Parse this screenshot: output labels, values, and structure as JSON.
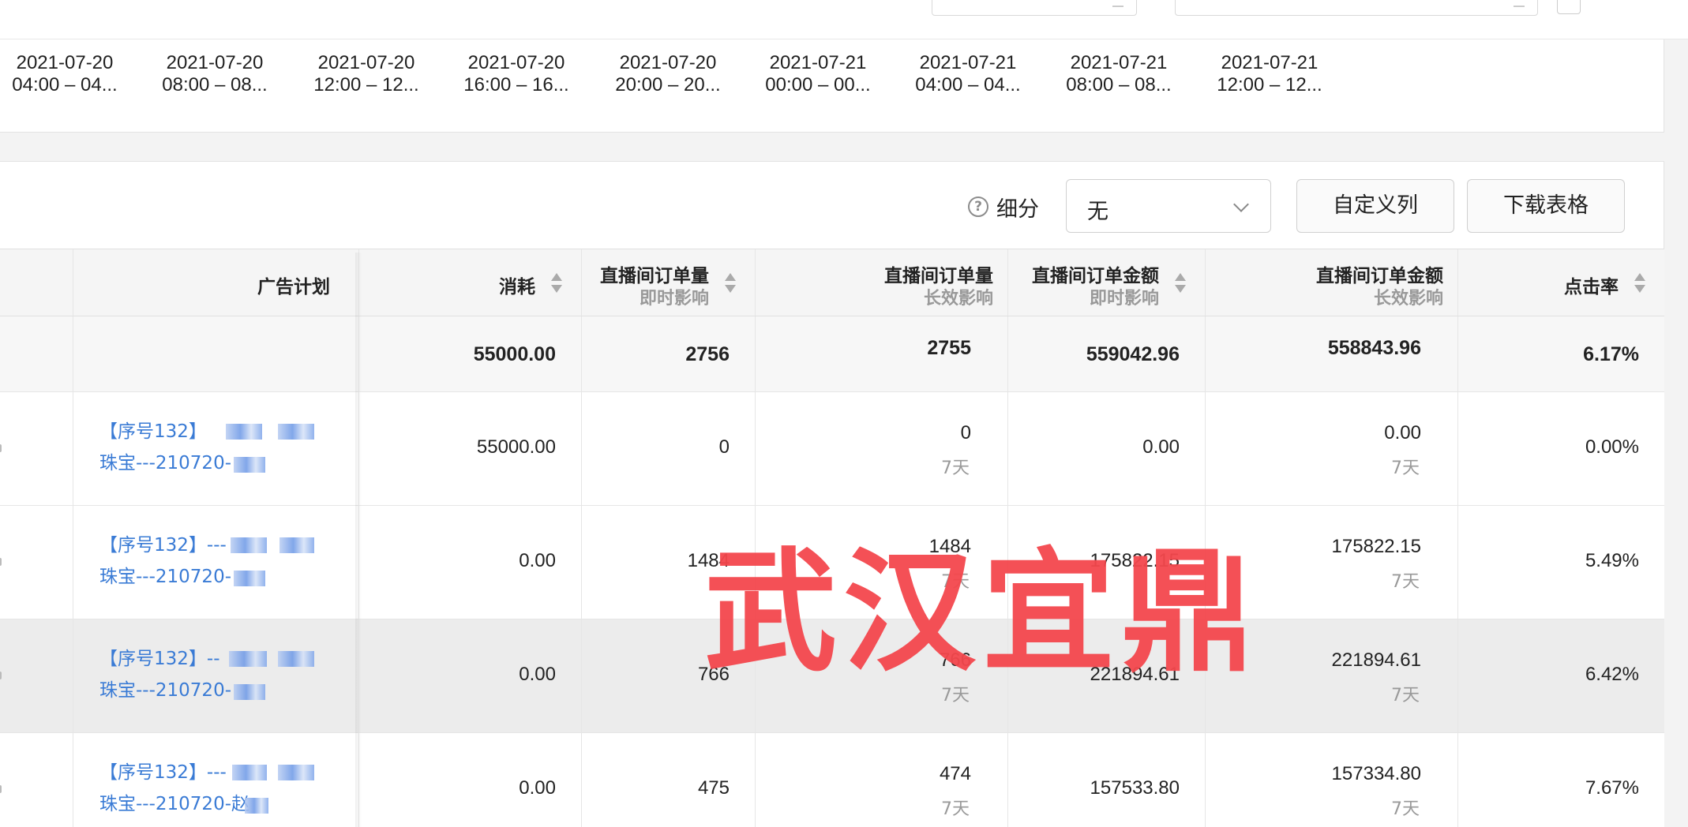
{
  "timeline": [
    {
      "date": "2021-07-20",
      "range": "04:00 – 04..."
    },
    {
      "date": "2021-07-20",
      "range": "08:00 – 08..."
    },
    {
      "date": "2021-07-20",
      "range": "12:00 – 12..."
    },
    {
      "date": "2021-07-20",
      "range": "16:00 – 16..."
    },
    {
      "date": "2021-07-20",
      "range": "20:00 – 20..."
    },
    {
      "date": "2021-07-21",
      "range": "00:00 – 00..."
    },
    {
      "date": "2021-07-21",
      "range": "04:00 – 04..."
    },
    {
      "date": "2021-07-21",
      "range": "08:00 – 08..."
    },
    {
      "date": "2021-07-21",
      "range": "12:00 – 12..."
    }
  ],
  "toolbar": {
    "segment_label": "细分",
    "segment_value": "无",
    "custom_columns": "自定义列",
    "download_table": "下载表格"
  },
  "columns": {
    "plan": "广告计划",
    "cost": "消耗",
    "orders_instant": {
      "title": "直播间订单量",
      "sub": "即时影响"
    },
    "orders_long": {
      "title": "直播间订单量",
      "sub": "长效影响"
    },
    "amount_instant": {
      "title": "直播间订单金额",
      "sub": "即时影响"
    },
    "amount_long": {
      "title": "直播间订单金额",
      "sub": "长效影响"
    },
    "ctr": "点击率"
  },
  "total": {
    "cost": "55000.00",
    "orders_instant": "2756",
    "orders_long": "2755",
    "amount_instant": "559042.96",
    "amount_long": "558843.96",
    "ctr": "6.17%"
  },
  "rows": [
    {
      "plan_l1": "【序号132】",
      "plan_l2": "珠宝---210720-",
      "cost": "55000.00",
      "orders_instant": "0",
      "orders_long": "0",
      "orders_long_sub": "7天",
      "amount_instant": "0.00",
      "amount_long": "0.00",
      "amount_long_sub": "7天",
      "ctr": "0.00%"
    },
    {
      "plan_l1": "【序号132】---",
      "plan_l2": "珠宝---210720-",
      "cost": "0.00",
      "orders_instant": "1484",
      "orders_long": "1484",
      "orders_long_sub": "7天",
      "amount_instant": "175822.15",
      "amount_long": "175822.15",
      "amount_long_sub": "7天",
      "ctr": "5.49%"
    },
    {
      "plan_l1": "【序号132】--",
      "plan_l2": "珠宝---210720-",
      "cost": "0.00",
      "orders_instant": "766",
      "orders_long": "766",
      "orders_long_sub": "7天",
      "amount_instant": "221894.61",
      "amount_long": "221894.61",
      "amount_long_sub": "7天",
      "ctr": "6.42%"
    },
    {
      "plan_l1": "【序号132】---",
      "plan_l2": "珠宝---210720-赵",
      "cost": "0.00",
      "orders_instant": "475",
      "orders_long": "474",
      "orders_long_sub": "7天",
      "amount_instant": "157533.80",
      "amount_long": "157334.80",
      "amount_long_sub": "7天",
      "ctr": "7.67%"
    }
  ],
  "watermark": "武汉宜鼎"
}
